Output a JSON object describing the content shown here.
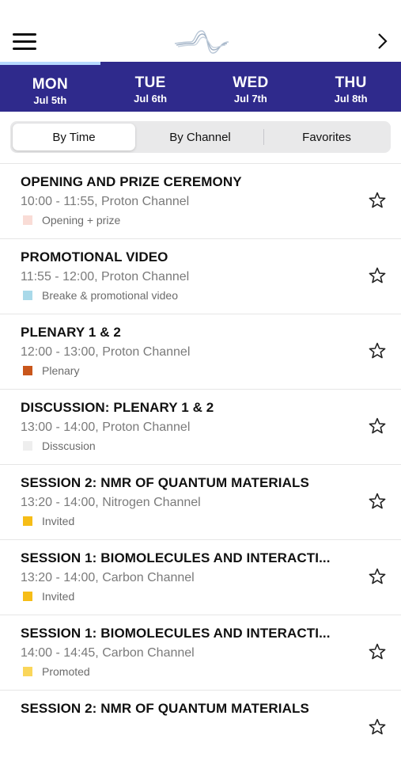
{
  "header": {
    "menu_icon": "hamburger-icon",
    "logo_icon": "wave-logo-icon",
    "next_icon": "chevron-right-icon"
  },
  "days": [
    {
      "day": "MON",
      "date": "Jul 5th"
    },
    {
      "day": "TUE",
      "date": "Jul 6th"
    },
    {
      "day": "WED",
      "date": "Jul 7th"
    },
    {
      "day": "THU",
      "date": "Jul 8th"
    }
  ],
  "day_progress": 0.25,
  "segments": [
    "By Time",
    "By Channel",
    "Favorites"
  ],
  "sessions": [
    {
      "title": "OPENING AND PRIZE CEREMONY",
      "time": "10:00 - 11:55, Proton Channel",
      "tag": "Opening + prize",
      "color": "#f9dcd6"
    },
    {
      "title": "PROMOTIONAL VIDEO",
      "time": "11:55 - 12:00, Proton Channel",
      "tag": "Breake & promotional video",
      "color": "#a9d9e9"
    },
    {
      "title": "PLENARY 1 & 2",
      "time": "12:00 - 13:00, Proton Channel",
      "tag": "Plenary",
      "color": "#c9561b"
    },
    {
      "title": "DISCUSSION: PLENARY 1 & 2",
      "time": "13:00 - 14:00, Proton Channel",
      "tag": "Disscusion",
      "color": "#eeeeee"
    },
    {
      "title": "SESSION 2: NMR OF QUANTUM MATERIALS",
      "time": "13:20 - 14:00, Nitrogen Channel",
      "tag": "Invited",
      "color": "#f6bd17"
    },
    {
      "title": "SESSION 1: BIOMOLECULES AND INTERACTI...",
      "time": "13:20 - 14:00, Carbon Channel",
      "tag": "Invited",
      "color": "#f6bd17"
    },
    {
      "title": "SESSION 1: BIOMOLECULES AND INTERACTI...",
      "time": "14:00 - 14:45, Carbon Channel",
      "tag": "Promoted",
      "color": "#fad65a"
    },
    {
      "title": "SESSION 2: NMR OF QUANTUM MATERIALS",
      "time": "",
      "tag": "",
      "color": ""
    }
  ],
  "colors": {
    "header_bg": "#2f2a8c",
    "progress": "#b7d9ff"
  }
}
